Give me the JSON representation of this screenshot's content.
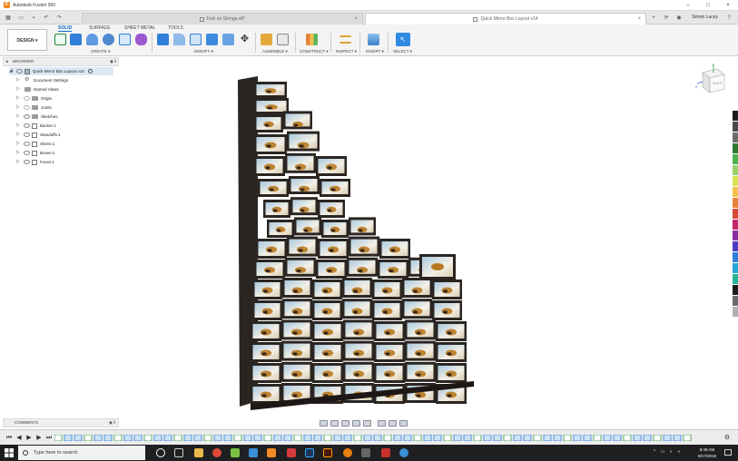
{
  "window": {
    "app_title": "Autodesk Fusion 360",
    "controls": [
      "–",
      "□",
      "×"
    ]
  },
  "tabs": [
    {
      "label": "Fish on Stringa v8*",
      "active": false
    },
    {
      "label": "Quick Mirror Box Layout v14",
      "active": true
    }
  ],
  "user": {
    "name": "Simon Lacey"
  },
  "toolbar": {
    "workspace": "DESIGN",
    "workspace_tabs": [
      "SOLID",
      "SURFACE",
      "SHEET METAL",
      "TOOLS"
    ],
    "active_tab": "SOLID",
    "groups": [
      "CREATE ▾",
      "MODIFY ▾",
      "ASSEMBLE ▾",
      "CONSTRUCT ▾",
      "INSPECT ▾",
      "INSERT ▾",
      "SELECT ▾"
    ]
  },
  "browser": {
    "title": "BROWSER",
    "root": "Quick Mirror Box Layout v14",
    "items": [
      {
        "label": "Document Settings",
        "icon": "gear-icon"
      },
      {
        "label": "Named Views",
        "icon": "folder-icon"
      },
      {
        "label": "Origin",
        "icon": "folder-icon"
      },
      {
        "label": "Joints",
        "icon": "folder-icon"
      },
      {
        "label": "Sketches",
        "icon": "folder-icon"
      },
      {
        "label": "Backer:1",
        "icon": "component-icon"
      },
      {
        "label": "Standoffs:1",
        "icon": "component-icon"
      },
      {
        "label": "Shims:1",
        "icon": "component-icon"
      },
      {
        "label": "Boxes:1",
        "icon": "component-icon"
      },
      {
        "label": "Foxes:1",
        "icon": "component-icon"
      }
    ]
  },
  "comments": {
    "title": "COMMENTS"
  },
  "viewcube": {
    "label": "RIGHT",
    "axis_z": "Z",
    "axis_y": "Y"
  },
  "taskbar": {
    "search_placeholder": "Type here to search",
    "time": "8:48 AM",
    "date": "9/17/2019"
  },
  "colors": {
    "accent": "#0a6ed1",
    "model_frame": "#2b2522",
    "taskbar": "#1f1f22"
  }
}
